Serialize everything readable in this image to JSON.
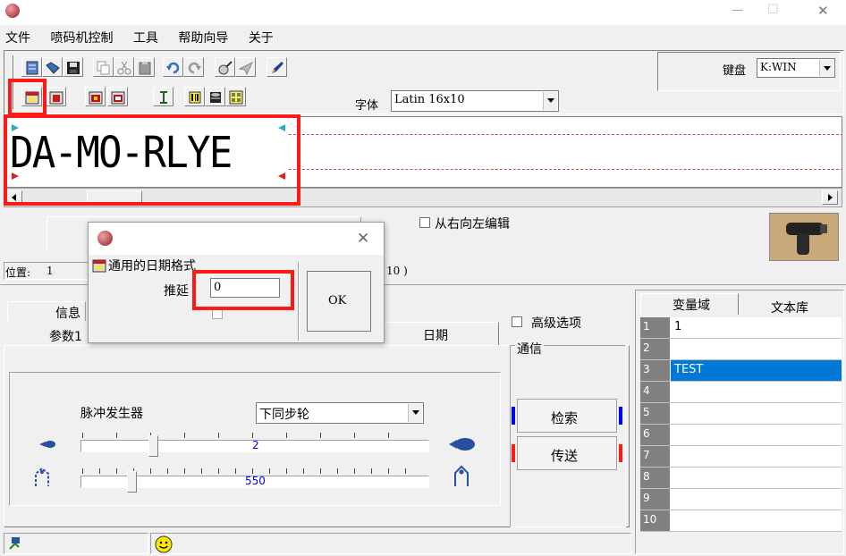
{
  "window": {
    "minimize": "—",
    "maximize": "☐",
    "close": "✕"
  },
  "menu": [
    "文件",
    "喷码机控制",
    "工具",
    "帮助向导",
    "关于"
  ],
  "keyboard": {
    "label": "键盘",
    "value": "K:WIN"
  },
  "font": {
    "label": "字体",
    "value": "Latin 16x10"
  },
  "message": {
    "text": "DA-MO-RLYE"
  },
  "rtl_label": "从右向左编辑",
  "position": {
    "label": "位置:",
    "value": "1",
    "extra": "10 )"
  },
  "dialog": {
    "title": "通用的日期格式",
    "delay_label": "推延",
    "delay_value": "0",
    "ok": "OK"
  },
  "tabs": {
    "info": "信息",
    "param": "参数1",
    "date": "日期"
  },
  "advanced": "高级选项",
  "comm": {
    "title": "通信",
    "search": "检索",
    "send": "传送"
  },
  "pulse": {
    "label": "脉冲发生器",
    "option": "下同步轮",
    "slider1": "2",
    "slider2": "550"
  },
  "var_panel": {
    "tab_var": "变量域",
    "tab_lib": "文本库",
    "rows": [
      {
        "n": "1",
        "v": "1"
      },
      {
        "n": "2",
        "v": ""
      },
      {
        "n": "3",
        "v": "TEST"
      },
      {
        "n": "4",
        "v": ""
      },
      {
        "n": "5",
        "v": ""
      },
      {
        "n": "6",
        "v": ""
      },
      {
        "n": "7",
        "v": ""
      },
      {
        "n": "8",
        "v": ""
      },
      {
        "n": "9",
        "v": ""
      },
      {
        "n": "10",
        "v": ""
      }
    ]
  },
  "colors": {
    "highlight": "#0078d7",
    "red": "#ff1a1a",
    "blue": "#0000ff"
  }
}
